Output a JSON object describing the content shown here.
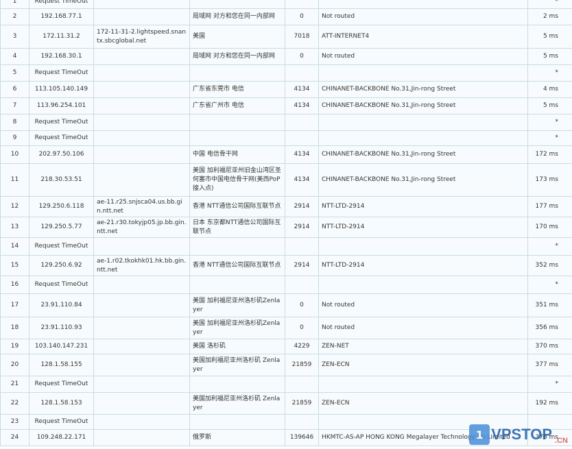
{
  "rows": [
    {
      "hop": "1",
      "ip": "Request TimeOut",
      "host": "",
      "loc": "",
      "asn": "",
      "isp": "",
      "time": "*"
    },
    {
      "hop": "2",
      "ip": "192.168.77.1",
      "host": "",
      "loc": "局域网 对方和您在同一内部网",
      "asn": "0",
      "isp": "Not routed",
      "time": "2 ms"
    },
    {
      "hop": "3",
      "ip": "172.11.31.2",
      "host": "172-11-31-2.lightspeed.snantx.sbcglobal.net",
      "loc": "美国",
      "asn": "7018",
      "isp": "ATT-INTERNET4",
      "time": "5 ms"
    },
    {
      "hop": "4",
      "ip": "192.168.30.1",
      "host": "",
      "loc": "局域网 对方和您在同一内部网",
      "asn": "0",
      "isp": "Not routed",
      "time": "5 ms"
    },
    {
      "hop": "5",
      "ip": "Request TimeOut",
      "host": "",
      "loc": "",
      "asn": "",
      "isp": "",
      "time": "*"
    },
    {
      "hop": "6",
      "ip": "113.105.140.149",
      "host": "",
      "loc": "广东省东莞市 电信",
      "asn": "4134",
      "isp": "CHINANET-BACKBONE No.31,Jin-rong Street",
      "time": "4 ms"
    },
    {
      "hop": "7",
      "ip": "113.96.254.101",
      "host": "",
      "loc": "广东省广州市 电信",
      "asn": "4134",
      "isp": "CHINANET-BACKBONE No.31,Jin-rong Street",
      "time": "5 ms"
    },
    {
      "hop": "8",
      "ip": "Request TimeOut",
      "host": "",
      "loc": "",
      "asn": "",
      "isp": "",
      "time": "*"
    },
    {
      "hop": "9",
      "ip": "Request TimeOut",
      "host": "",
      "loc": "",
      "asn": "",
      "isp": "",
      "time": "*"
    },
    {
      "hop": "10",
      "ip": "202.97.50.106",
      "host": "",
      "loc": "中国 电信骨干网",
      "asn": "4134",
      "isp": "CHINANET-BACKBONE No.31,Jin-rong Street",
      "time": "172 ms"
    },
    {
      "hop": "11",
      "ip": "218.30.53.51",
      "host": "",
      "loc": "美国 加利福尼亚州旧金山湾区圣何塞市中国电信骨干网(美西PoP接入点)",
      "asn": "4134",
      "isp": "CHINANET-BACKBONE No.31,Jin-rong Street",
      "time": "173 ms"
    },
    {
      "hop": "12",
      "ip": "129.250.6.118",
      "host": "ae-11.r25.snjsca04.us.bb.gin.ntt.net",
      "loc": "香港 NTT通信公司国际互联节点",
      "asn": "2914",
      "isp": "NTT-LTD-2914",
      "time": "177 ms"
    },
    {
      "hop": "13",
      "ip": "129.250.5.77",
      "host": "ae-21.r30.tokyjp05.jp.bb.gin.ntt.net",
      "loc": "日本 东京都NTT通信公司国际互联节点",
      "asn": "2914",
      "isp": "NTT-LTD-2914",
      "time": "170 ms"
    },
    {
      "hop": "14",
      "ip": "Request TimeOut",
      "host": "",
      "loc": "",
      "asn": "",
      "isp": "",
      "time": "*"
    },
    {
      "hop": "15",
      "ip": "129.250.6.92",
      "host": "ae-1.r02.tkokhk01.hk.bb.gin.ntt.net",
      "loc": "香港 NTT通信公司国际互联节点",
      "asn": "2914",
      "isp": "NTT-LTD-2914",
      "time": "352 ms"
    },
    {
      "hop": "16",
      "ip": "Request TimeOut",
      "host": "",
      "loc": "",
      "asn": "",
      "isp": "",
      "time": "*"
    },
    {
      "hop": "17",
      "ip": "23.91.110.84",
      "host": "",
      "loc": "美国 加利福尼亚州洛杉矶Zenlayer",
      "asn": "0",
      "isp": "Not routed",
      "time": "351 ms"
    },
    {
      "hop": "18",
      "ip": "23.91.110.93",
      "host": "",
      "loc": "美国 加利福尼亚州洛杉矶Zenlayer",
      "asn": "0",
      "isp": "Not routed",
      "time": "356 ms"
    },
    {
      "hop": "19",
      "ip": "103.140.147.231",
      "host": "",
      "loc": "美国 洛杉矶",
      "asn": "4229",
      "isp": "ZEN-NET",
      "time": "370 ms"
    },
    {
      "hop": "20",
      "ip": "128.1.58.155",
      "host": "",
      "loc": "美国加利福尼亚州洛杉矶 Zenlayer",
      "asn": "21859",
      "isp": "ZEN-ECN",
      "time": "377 ms"
    },
    {
      "hop": "21",
      "ip": "Request TimeOut",
      "host": "",
      "loc": "",
      "asn": "",
      "isp": "",
      "time": "*"
    },
    {
      "hop": "22",
      "ip": "128.1.58.153",
      "host": "",
      "loc": "美国加利福尼亚州洛杉矶 Zenlayer",
      "asn": "21859",
      "isp": "ZEN-ECN",
      "time": "192 ms"
    },
    {
      "hop": "23",
      "ip": "Request TimeOut",
      "host": "",
      "loc": "",
      "asn": "",
      "isp": "",
      "time": ""
    },
    {
      "hop": "24",
      "ip": "109.248.22.171",
      "host": "",
      "loc": "俄罗斯",
      "asn": "139646",
      "isp": "HKMTC-AS-AP HONG KONG Megalayer Technology Co.Limited",
      "time": "376 ms"
    }
  ],
  "watermark": {
    "badge": "1",
    "text": "VPSTOP",
    "suffix": ".CN"
  }
}
